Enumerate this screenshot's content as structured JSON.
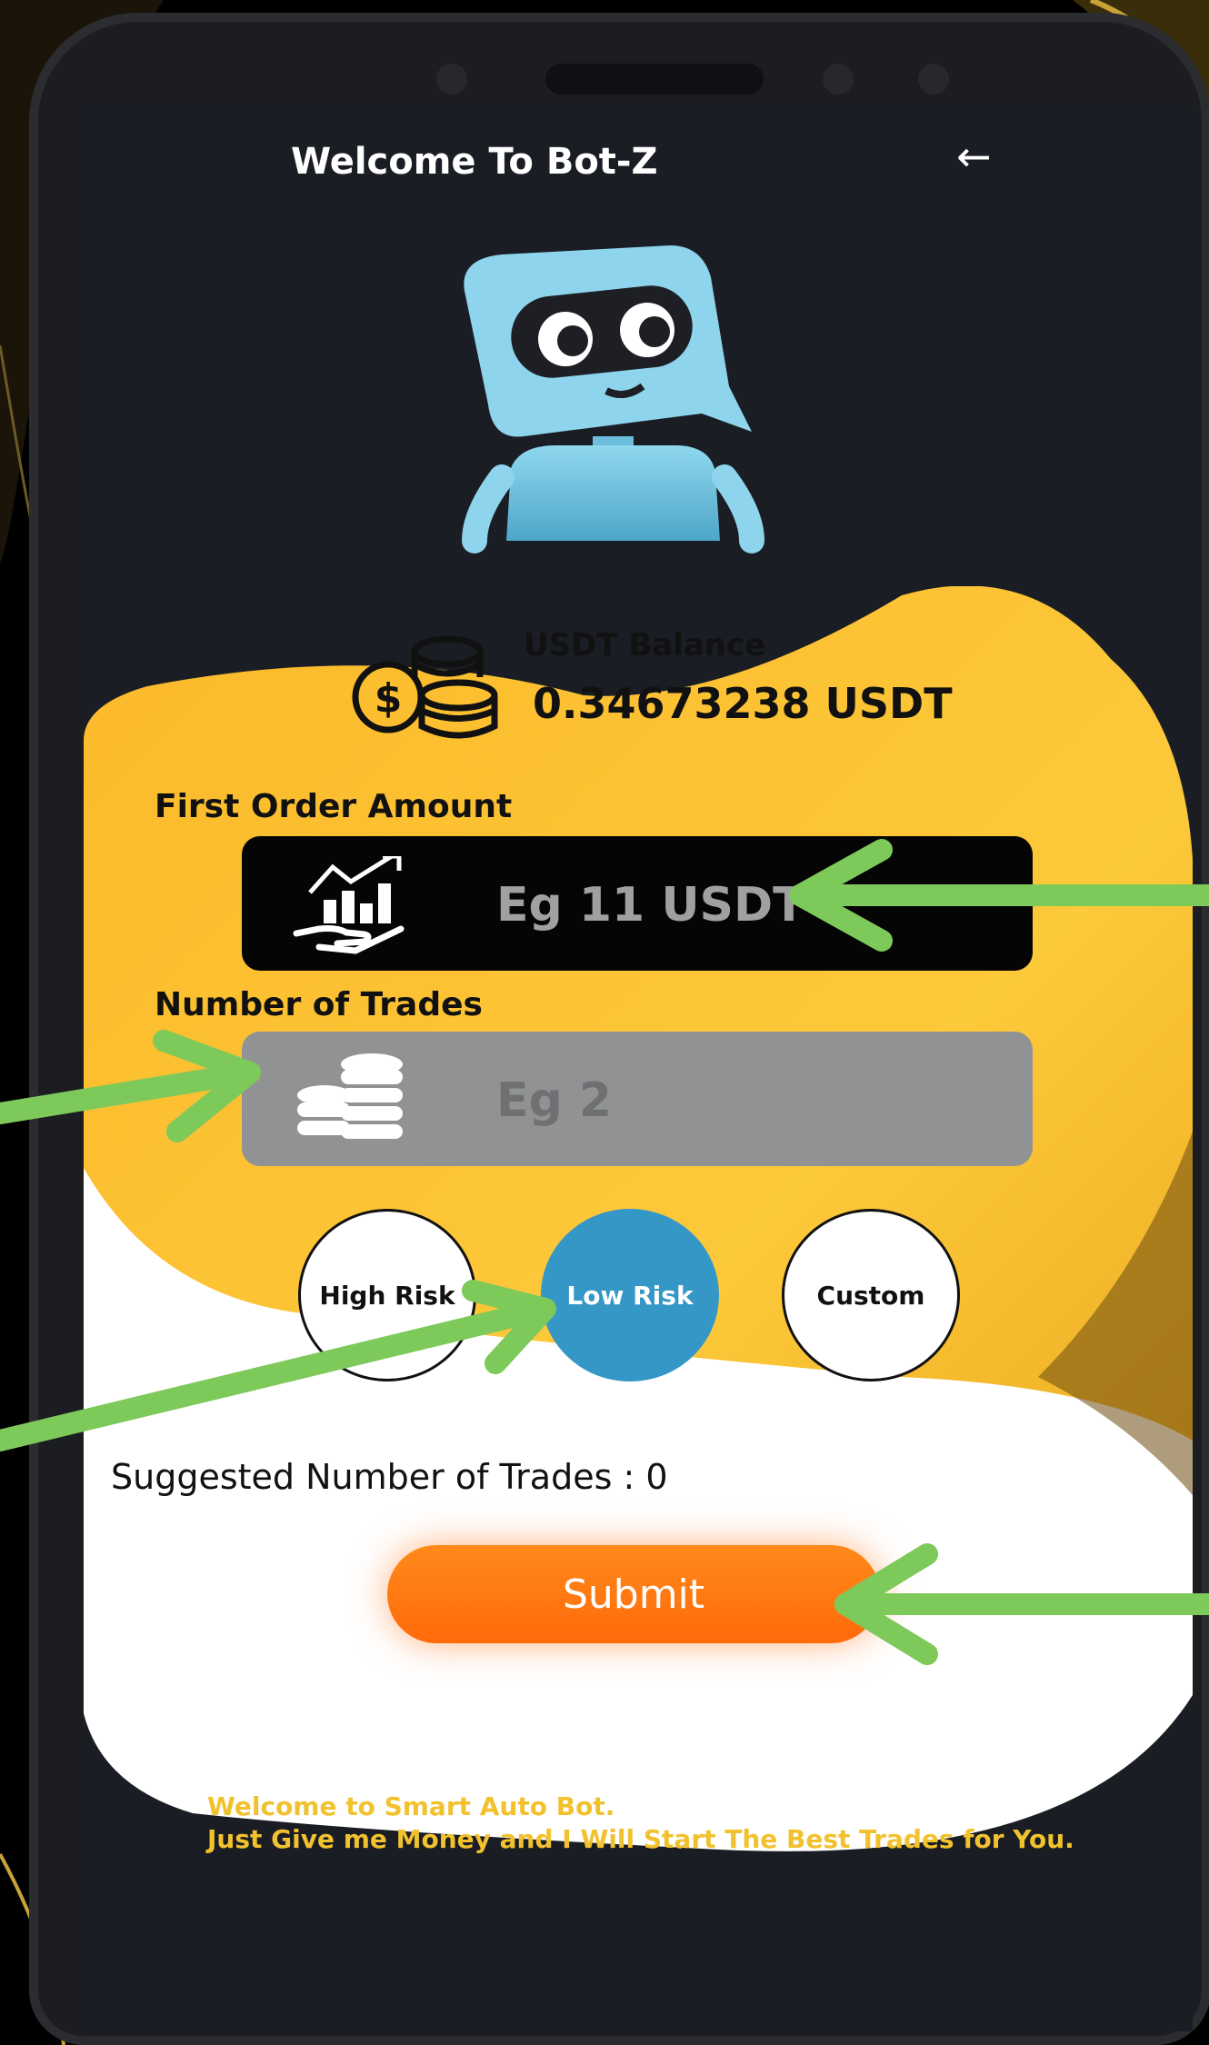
{
  "header": {
    "title": "Welcome To Bot-Z",
    "back_icon": "back-arrow-icon"
  },
  "balance": {
    "label": "USDT Balance",
    "value": "0.34673238 USDT",
    "icon": "coins-dollar-icon"
  },
  "first_order": {
    "label": "First Order Amount",
    "placeholder": "Eg 11 USDT",
    "icon": "hand-chart-icon"
  },
  "trades": {
    "label": "Number of Trades",
    "placeholder": "Eg 2",
    "icon": "coin-stack-icon"
  },
  "risk_options": {
    "high": "High Risk",
    "low": "Low Risk",
    "custom": "Custom",
    "selected": "Low Risk"
  },
  "suggested": "Suggested Number of Trades : 0",
  "submit_label": "Submit",
  "footer": {
    "line1": "Welcome to Smart Auto Bot.",
    "line2": "Just Give me Money and I Will Start The Best Trades for You."
  },
  "colors": {
    "accent_yellow": "#fbc52a",
    "low_risk_blue": "#3597c6",
    "submit_orange": "#ff7410",
    "annotation_green": "#7dc95a",
    "screen_dark": "#1a1d24"
  }
}
